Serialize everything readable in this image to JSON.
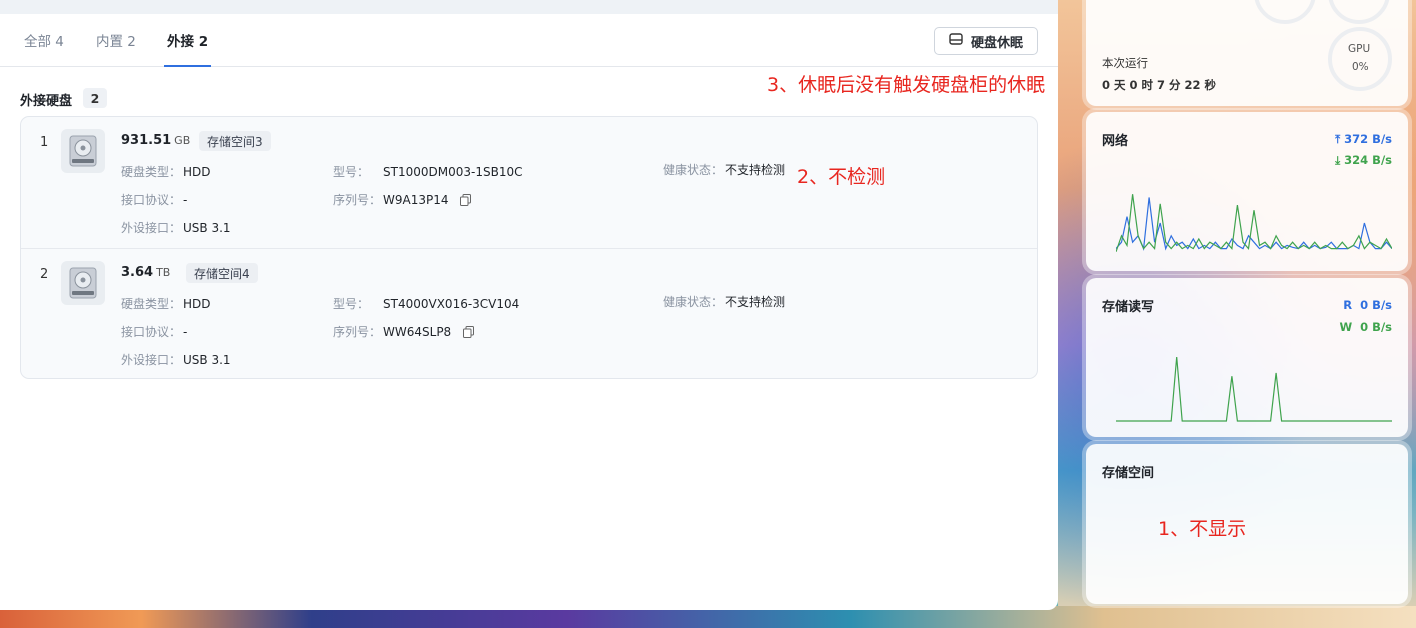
{
  "tabs": [
    {
      "label": "全部 4",
      "active": false
    },
    {
      "label": "内置 2",
      "active": false
    },
    {
      "label": "外接 2",
      "active": true
    }
  ],
  "sleep_button": {
    "label": "硬盘休眠",
    "icon": "printer-like-drive-icon"
  },
  "section": {
    "title": "外接硬盘",
    "count": "2"
  },
  "labels": {
    "type": "硬盘类型：",
    "protocol": "接口协议：",
    "port": "外设接口：",
    "model": "型号：",
    "serial": "序列号：",
    "health": "健康状态："
  },
  "disks": [
    {
      "index": "1",
      "size": "931.51",
      "unit": "GB",
      "space": "存储空间3",
      "type": "HDD",
      "protocol": "-",
      "port": "USB 3.1",
      "model": "ST1000DM003-1SB10C",
      "serial": "W9A13P14",
      "health": "不支持检测"
    },
    {
      "index": "2",
      "size": "3.64",
      "unit": "TB",
      "space": "存储空间4",
      "type": "HDD",
      "protocol": "-",
      "port": "USB 3.1",
      "model": "ST4000VX016-3CV104",
      "serial": "WW64SLP8",
      "health": "不支持检测"
    }
  ],
  "annotations": {
    "a3": "3、休眠后没有触发硬盘柜的休眠",
    "a2": "2、不检测",
    "a1": "1、不显示"
  },
  "widgets": {
    "status": {
      "uptime_label": "本次运行",
      "uptime_value": "0 天 0 时 7 分 22 秒",
      "gpu_label": "GPU",
      "gpu_value": "0%"
    },
    "network": {
      "title": "网络",
      "up": "372 B/s",
      "down": "324 B/s",
      "colors": {
        "up": "#2f6fdf",
        "down": "#3fa34d"
      }
    },
    "storage_io": {
      "title": "存储读写",
      "read_label": "R",
      "read": "0 B/s",
      "write_label": "W",
      "write": "0 B/s"
    },
    "storage_space": {
      "title": "存储空间"
    }
  },
  "chart_data": [
    {
      "type": "line",
      "chart": "network",
      "series": [
        {
          "values": [
            0.1,
            0.2,
            0.6,
            0.2,
            0.3,
            0.1,
            0.9,
            0.2,
            0.5,
            0.1,
            0.3,
            0.15,
            0.2,
            0.1,
            0.25,
            0.1,
            0.15,
            0.1,
            0.2,
            0.1,
            0.1,
            0.25,
            0.15,
            0.1,
            0.3,
            0.2,
            0.1,
            0.15,
            0.1,
            0.2,
            0.1,
            0.15,
            0.12,
            0.1,
            0.2,
            0.1,
            0.15,
            0.1,
            0.12,
            0.2,
            0.1,
            0.1,
            0.1,
            0.15,
            0.1,
            0.5,
            0.2,
            0.1,
            0.1,
            0.2,
            0.1
          ]
        },
        {
          "values": [
            0.05,
            0.3,
            0.15,
            0.95,
            0.3,
            0.1,
            0.2,
            0.1,
            0.8,
            0.2,
            0.1,
            0.2,
            0.1,
            0.15,
            0.1,
            0.25,
            0.1,
            0.2,
            0.15,
            0.1,
            0.2,
            0.1,
            0.78,
            0.2,
            0.1,
            0.7,
            0.15,
            0.2,
            0.1,
            0.3,
            0.15,
            0.1,
            0.2,
            0.1,
            0.15,
            0.1,
            0.2,
            0.1,
            0.15,
            0.1,
            0.1,
            0.2,
            0.1,
            0.15,
            0.3,
            0.1,
            0.2,
            0.15,
            0.1,
            0.25,
            0.1
          ]
        }
      ]
    },
    {
      "type": "line",
      "chart": "storage_io",
      "series": [
        {
          "values": [
            0,
            0,
            0,
            0,
            0,
            0,
            0,
            0,
            0,
            0,
            0,
            1,
            0,
            0,
            0,
            0,
            0,
            0,
            0,
            0,
            0,
            0.7,
            0,
            0,
            0,
            0,
            0,
            0,
            0,
            0.75,
            0,
            0,
            0,
            0,
            0,
            0,
            0,
            0,
            0,
            0,
            0,
            0,
            0,
            0,
            0,
            0,
            0,
            0,
            0,
            0,
            0
          ]
        }
      ]
    }
  ]
}
